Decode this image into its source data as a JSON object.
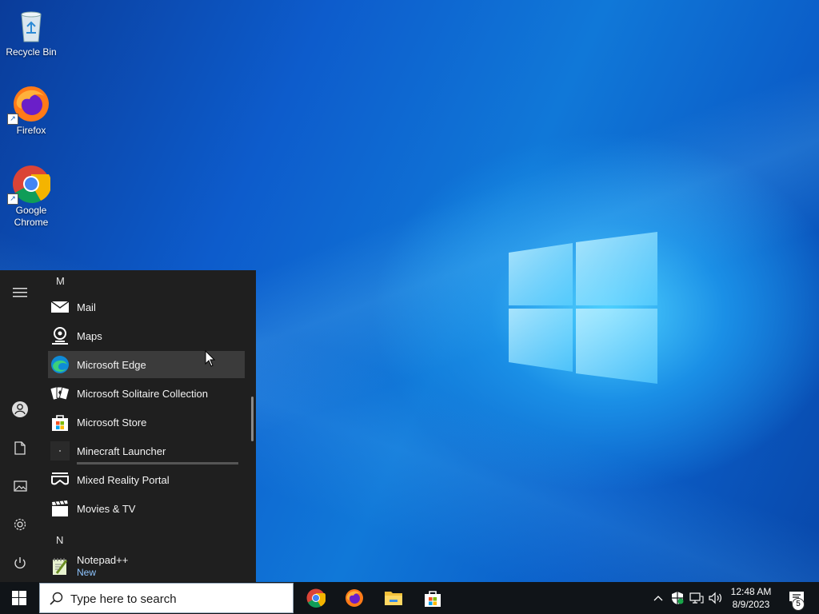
{
  "desktop": {
    "icons": [
      {
        "label": "Recycle Bin",
        "icon": "recycle-bin-icon"
      },
      {
        "label": "Firefox",
        "icon": "firefox-icon"
      },
      {
        "label": "Google\nChrome",
        "icon": "chrome-icon"
      }
    ]
  },
  "start_menu": {
    "rail": [
      "hamburger-menu-icon",
      "user-icon",
      "documents-icon",
      "pictures-icon",
      "settings-gear-icon",
      "power-icon"
    ],
    "sections": [
      {
        "letter": "M"
      },
      {
        "letter": "N"
      }
    ],
    "apps": [
      {
        "name": "Mail",
        "icon": "mail-icon"
      },
      {
        "name": "Maps",
        "icon": "maps-icon"
      },
      {
        "name": "Microsoft Edge",
        "icon": "edge-icon",
        "hovered": true
      },
      {
        "name": "Microsoft Solitaire Collection",
        "icon": "solitaire-icon"
      },
      {
        "name": "Microsoft Store",
        "icon": "store-icon"
      },
      {
        "name": "Minecraft Launcher",
        "icon": "minecraft-icon",
        "installing": true
      },
      {
        "name": "Mixed Reality Portal",
        "icon": "mixed-reality-icon"
      },
      {
        "name": "Movies & TV",
        "icon": "movies-tv-icon"
      },
      {
        "name": "Notepad++",
        "icon": "notepadpp-icon",
        "sub": "New"
      }
    ]
  },
  "taskbar": {
    "search_placeholder": "Type here to search",
    "pinned": [
      "chrome-icon",
      "firefox-icon",
      "file-explorer-icon",
      "store-icon"
    ],
    "clock": {
      "time": "12:48 AM",
      "date": "8/9/2023"
    },
    "notification_count": "5"
  },
  "colors": {
    "accent": "#0078d7",
    "start_bg": "#1f1f1f",
    "hover": "#3b3b3b",
    "taskbar_bg": "#101418"
  }
}
